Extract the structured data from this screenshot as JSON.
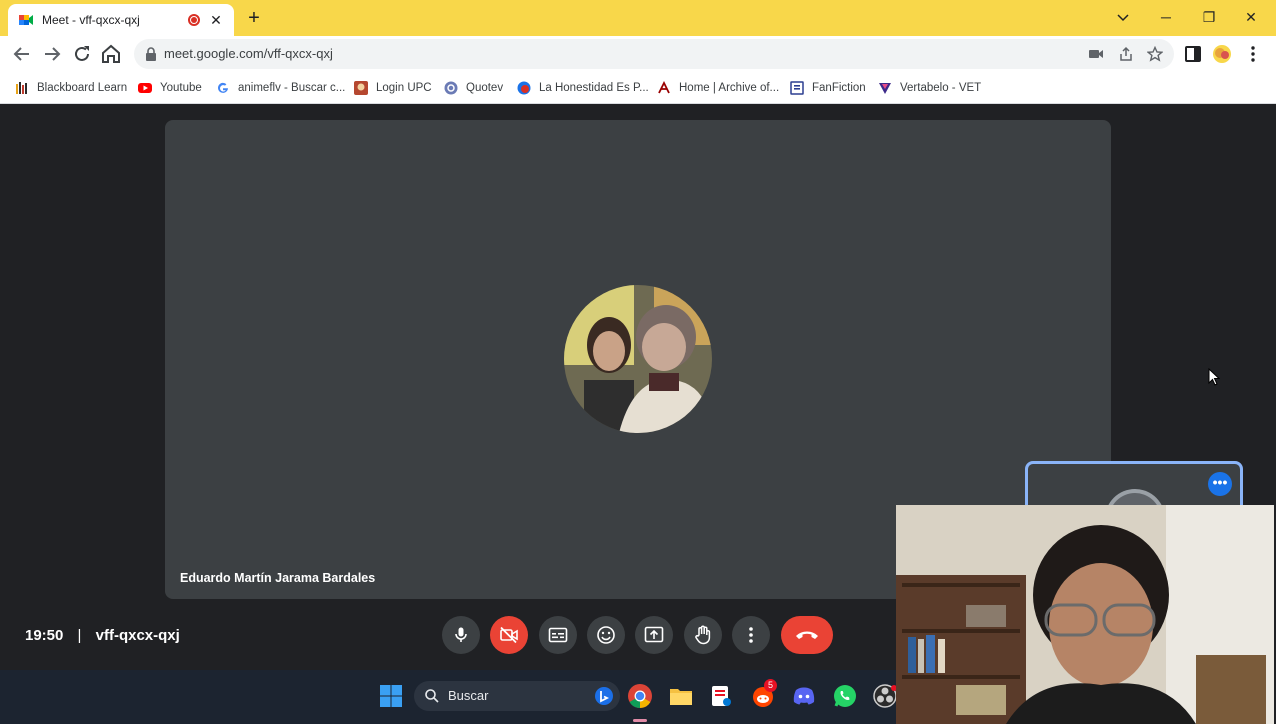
{
  "browser": {
    "tab": {
      "title": "Meet - vff-qxcx-qxj",
      "close": "✕"
    },
    "new_tab": "+",
    "window": {
      "minimize": "─",
      "maximize": "❐",
      "close": "✕"
    },
    "url": "meet.google.com/vff-qxcx-qxj",
    "bookmarks": [
      {
        "label": "Blackboard Learn",
        "icon": "blackboard-icon",
        "color": "#2b2b2b"
      },
      {
        "label": "Youtube",
        "icon": "youtube-icon",
        "color": "#ff0000"
      },
      {
        "label": "animeflv - Buscar c...",
        "icon": "google-icon",
        "color": "#4285f4"
      },
      {
        "label": "Login UPC",
        "icon": "upc-icon",
        "color": "#b5472f"
      },
      {
        "label": "Quotev",
        "icon": "quotev-icon",
        "color": "#6b7bb5"
      },
      {
        "label": "La Honestidad Es P...",
        "icon": "honestidad-icon",
        "color": "#d93025"
      },
      {
        "label": "Home | Archive of...",
        "icon": "ao3-icon",
        "color": "#990000"
      },
      {
        "label": "FanFiction",
        "icon": "fanfiction-icon",
        "color": "#2c3e91"
      },
      {
        "label": "Vertabelo - VET",
        "icon": "vertabelo-icon",
        "color": "#3d2a8a"
      }
    ]
  },
  "meet": {
    "participant_name": "Eduardo Martín Jarama Bardales",
    "time": "19:50",
    "separator": "|",
    "meeting_code": "vff-qxcx-qxj"
  },
  "taskbar": {
    "search_label": "Buscar",
    "reddit_badge": "5"
  },
  "colors": {
    "chrome_frame": "#f8d74a",
    "meet_bg": "#202124",
    "tile_bg": "#3c4043",
    "end_call": "#ea4335",
    "self_tile_border": "#8ab4f8"
  }
}
